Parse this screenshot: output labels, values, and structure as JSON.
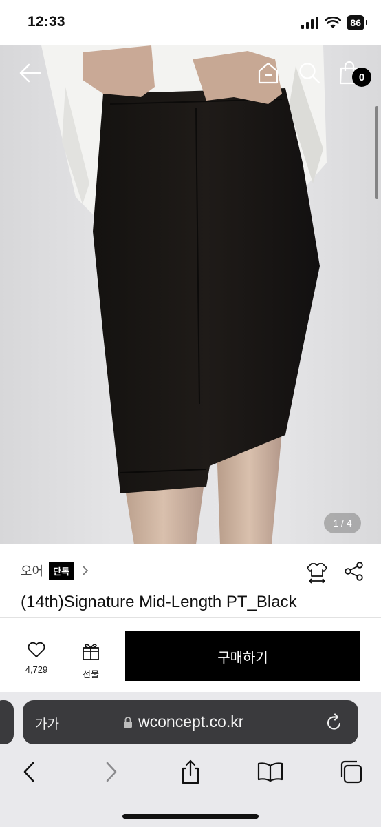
{
  "status_bar": {
    "time": "12:33",
    "battery": "86"
  },
  "image_header": {
    "cart_count": "0"
  },
  "gallery": {
    "pager": "1 / 4"
  },
  "product": {
    "brand": "오어",
    "exclusive_badge": "단독",
    "title": "(14th)Signature Mid-Length PT_Black"
  },
  "actions": {
    "like_count": "4,729",
    "gift_label": "선물",
    "buy_label": "구매하기"
  },
  "browser": {
    "aa_label": "가가",
    "url": "wconcept.co.kr"
  },
  "icons": {
    "nav": [
      "back-arrow-icon",
      "home-icon",
      "search-icon",
      "cart-icon"
    ],
    "info": [
      "size-guide-icon",
      "share-icon"
    ],
    "actions": [
      "heart-icon",
      "gift-icon"
    ],
    "toolbar": [
      "back-icon",
      "forward-icon",
      "share-icon",
      "bookmarks-icon",
      "tabs-icon"
    ]
  },
  "colors": {
    "buy_button": "#000000",
    "address_bar": "#3a3a3d",
    "browser_bg": "#e9e9ec"
  }
}
